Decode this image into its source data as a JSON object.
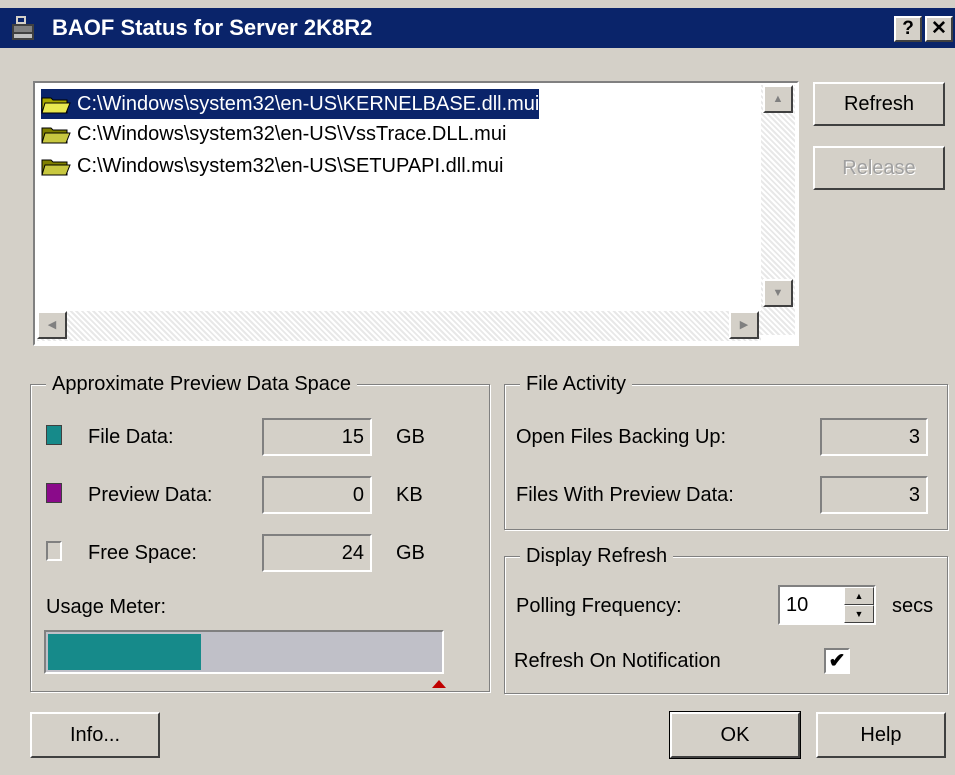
{
  "window": {
    "title": "BAOF Status for Server 2K8R2",
    "help_glyph": "?",
    "close_glyph": "✕"
  },
  "files": [
    {
      "path": "C:\\Windows\\system32\\en-US\\KERNELBASE.dll.mui",
      "selected": true
    },
    {
      "path": "C:\\Windows\\system32\\en-US\\VssTrace.DLL.mui",
      "selected": false
    },
    {
      "path": "C:\\Windows\\system32\\en-US\\SETUPAPI.dll.mui",
      "selected": false
    }
  ],
  "buttons": {
    "refresh": "Refresh",
    "release": "Release",
    "info": "Info...",
    "ok": "OK",
    "help": "Help"
  },
  "space": {
    "title": "Approximate Preview Data Space",
    "file_data": {
      "label": "File Data:",
      "value": "15",
      "unit": "GB",
      "color": "#168a8a"
    },
    "preview_data": {
      "label": "Preview Data:",
      "value": "0",
      "unit": "KB",
      "color": "#8a0a8a"
    },
    "free_space": {
      "label": "Free Space:",
      "value": "24",
      "unit": "GB",
      "color": "#d4d0c8"
    },
    "usage_label": "Usage Meter:",
    "usage_fraction": 0.39
  },
  "activity": {
    "title": "File Activity",
    "open_files": {
      "label": "Open Files Backing Up:",
      "value": "3"
    },
    "preview_files": {
      "label": "Files With Preview Data:",
      "value": "3"
    }
  },
  "refresh": {
    "title": "Display Refresh",
    "polling_label": "Polling Frequency:",
    "polling_value": "10",
    "polling_unit": "secs",
    "notify_label": "Refresh On Notification",
    "notify_checked": true
  }
}
